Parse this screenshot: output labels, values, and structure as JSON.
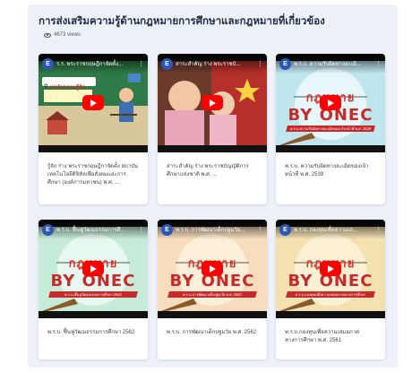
{
  "page": {
    "title": "การส่งเสริมความรู้ด้านกฎหมายการศึกษาและกฎหมายที่เกี่ยวข้อง",
    "views": "4673 views"
  },
  "art": {
    "word_law": "กฎหมาย",
    "word_by": "BY ONEC"
  },
  "videos": [
    {
      "channel_initial": "E",
      "overlay_title": "ร.ร. พระราชกฤษฎีกาจัดตั้ง...",
      "search_text": "มาทำความรู้จัก...",
      "caption": "รู้จัก ร่าง พระราชกฤษฎีกาจัดตั้ง สถาบันเทคโนโลยีดิจิทัลเพื่อสังคมและการศึกษา (องค์การมหาชน) พ.ศ. ...",
      "theme": "#2f7a46"
    },
    {
      "channel_initial": "E",
      "overlay_title": "สาระสำคัญ ร่าง พระราชบั...",
      "caption": "สาระสำคัญ ร่าง พระราชบัญญัติการศึกษาแห่งชาติ พ.ศ. ...",
      "theme": "#6b3a2a"
    },
    {
      "channel_initial": "E",
      "overlay_title": "พ.ร.บ. ความรับผิดทางละเมิ...",
      "band_text": "พ.ร.บ.ความรับผิดทางละเมิดของเจ้าหน้าที่ พ.ศ. 2539",
      "caption": "พ.ร.บ. ความรับผิดทางละเมิดของเจ้าหน้าที่ พ.ศ. 2539",
      "theme": "#bfe6ee"
    },
    {
      "channel_initial": "E",
      "overlay_title": "พ.ร.บ. ฟื้นฟูวัฒนธรรมการศึ...",
      "band_text": "พ.ร.บ.ฟื้นฟูวัฒนธรรมการศึกษา 2562",
      "caption": "พ.ร.บ. ฟื้นฟูวัฒนธรรมการศึกษา 2562",
      "theme": "#c6ecd9"
    },
    {
      "channel_initial": "E",
      "overlay_title": "พ.ร.บ. การพัฒนาเด็กปฐมวัย...",
      "band_text": "พ.ร.บ.การพัฒนาเด็กปฐมวัย พ.ศ. 2562",
      "caption": "พ.ร.บ. การพัฒนาเด็กปฐมวัย พ.ศ. 2562",
      "theme": "#f7ddbd"
    },
    {
      "channel_initial": "E",
      "overlay_title": "พ.ร.บ. กองทุนเพื่อความเส...",
      "band_text": "พ.ร.บ.กองทุนเพื่อความเสมอภาคทางการศึกษา",
      "caption": "พ.ร.บ.กองทุนเพื่อความเสมอภาคทางการศึกษา พ.ศ. 2561",
      "theme": "#f4e1b0"
    }
  ]
}
